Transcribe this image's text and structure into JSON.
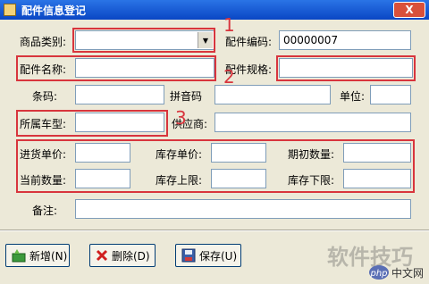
{
  "window": {
    "title": "配件信息登记",
    "close_label": "X"
  },
  "form": {
    "category_label": "商品类别:",
    "category_value": "",
    "part_code_label": "配件编码:",
    "part_code_value": "00000007",
    "part_name_label": "配件名称:",
    "part_spec_label": "配件规格:",
    "barcode_label": "条码:",
    "pinyin_label": "拼音码",
    "unit_label": "单位:",
    "vehicle_type_label": "所属车型:",
    "supplier_label": "供应商:",
    "purchase_price_label": "进货单价:",
    "stock_price_label": "库存单价:",
    "initial_qty_label": "期初数量:",
    "current_qty_label": "当前数量:",
    "stock_upper_label": "库存上限:",
    "stock_lower_label": "库存下限:",
    "remark_label": "备注:"
  },
  "annotations": [
    "1",
    "2",
    "3"
  ],
  "buttons": {
    "add": "新增(N)",
    "delete": "删除(D)",
    "save": "保存(U)"
  },
  "watermark": "软件技巧",
  "logo_text": "php中文网",
  "colors": {
    "titlebar": "#0a46c4",
    "annotation_red": "#d8353d",
    "background": "#ece9d8"
  },
  "icons": [
    "app-window-icon",
    "close-icon",
    "dropdown-arrow-icon",
    "add-icon",
    "delete-icon",
    "save-icon"
  ]
}
